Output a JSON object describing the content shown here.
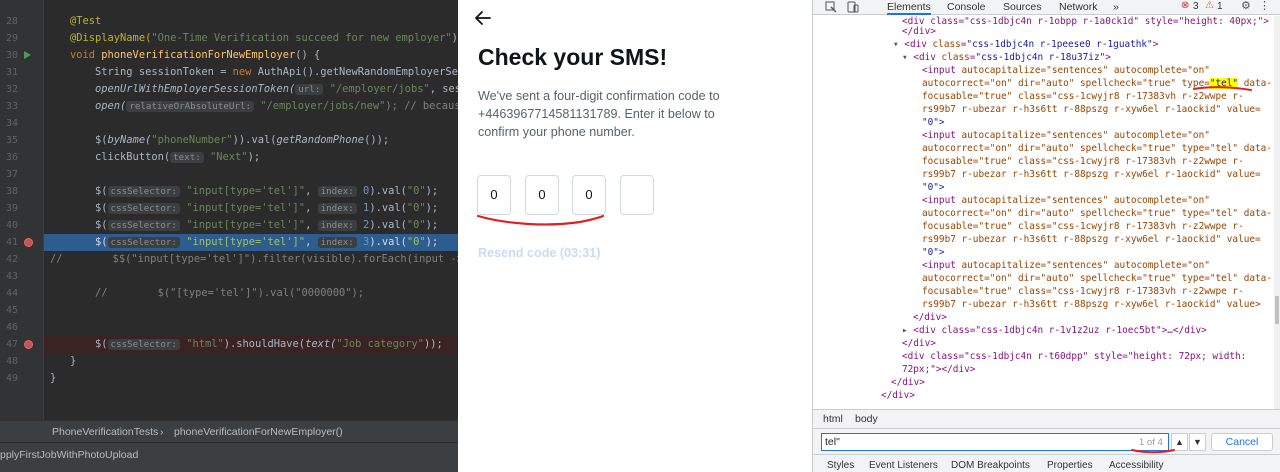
{
  "ide": {
    "line_numbers": [
      "28",
      "29",
      "30",
      "31",
      "32",
      "33",
      "34",
      "35",
      "36",
      "37",
      "38",
      "39",
      "40",
      "41",
      "42",
      "43",
      "44",
      "45",
      "46",
      "47",
      "48",
      "49"
    ],
    "annotation_test": "@Test",
    "display_name_call": "@DisplayName(",
    "display_name_value": "\"One-Time Verification succeed for new employer\"",
    "display_name_close": ")",
    "method_sig_kw": "void ",
    "method_name": "phoneVerificationForNewEmployer",
    "method_sig_end": "() {",
    "l31a": "    String sessionToken = ",
    "l31b": "new ",
    "l31c": "AuthApi().getNewRandomEmployerSessi",
    "l32a": "    openUrlWithEmployerSessionToken(",
    "l32hint": "url:",
    "l32b": " \"/employer/jobs\"",
    "l32c": ", sessio",
    "l33a": "    open(",
    "l33hint": "relativeOrAbsoluteUrl:",
    "l33b": " \"/employer/jobs/new\"",
    "l33c": "); // because of",
    "l35a": "    $(",
    "l35b": "byName(",
    "l35c": "\"phoneNumber\"",
    "l35d": ")).val(",
    "l35e": "getRandomPhone",
    "l35f": "());",
    "l36a": "    clickButton(",
    "l36hint": "text:",
    "l36b": " \"Next\"",
    "l36c": ");",
    "dollar": "    $(",
    "css_hint": "cssSelector:",
    "tel_selector": " \"input[type='tel']\"",
    "comma": ",",
    "index_hint": "index:",
    "idx0": " 0",
    "idx1": " 1",
    "idx2": " 2",
    "idx3": " 3",
    "val_zero_a": ").val(",
    "val_zero_b": "\"0\"",
    "val_zero_c": ");",
    "l42": "//        $$(\"input[type='tel']\").filter(visible).forEach(input -> in",
    "l44": "    //        $(\"[type='tel']\").val(\"0000000\");",
    "html_selector": " \"html\"",
    "should_have": ").shouldHave(",
    "text_fn": "text(",
    "job_category": "\"Job category\"",
    "should_close": "));",
    "brace_close_inner": "}",
    "brace_close_outer": "}",
    "breadcrumb_class": "PhoneVerificationTests",
    "breadcrumb_sep": "›",
    "breadcrumb_method": "phoneVerificationForNewEmployer()",
    "run_config": "pplyFirstJobWithPhotoUpload"
  },
  "page": {
    "title": "Check your SMS!",
    "description": "We've sent a four-digit confirmation code to +4463967714581131789. Enter it below to confirm your phone number.",
    "code_digits": [
      "0",
      "0",
      "0",
      ""
    ],
    "resend": "Resend code (03:31)"
  },
  "devtools": {
    "tabs": [
      "Elements",
      "Console",
      "Sources",
      "Network",
      "»"
    ],
    "error_count": "3",
    "warning_count": "1",
    "tree": {
      "line0": "<div class=\"css-1dbjc4n r-1obpp r-1a0ck1d\" style=\"height: 40px;\">",
      "line1": "</div>",
      "line2_tag": "<div ",
      "line2_attr": "class",
      "line2_val": "\"css-1dbjc4n r-1peese0 r-1guathk\"",
      "line3_val": "\"css-1dbjc4n r-18u37iz\"",
      "input_attrs_1": "autocapitalize=\"sentences\" autocomplete=\"on\"",
      "input_attrs_2a": "autocorrect=\"on\" dir=\"auto\" spellcheck=\"true\" type=",
      "input_attrs_2b": "\"tel\"",
      "input_attrs_2c": " data-",
      "input_attrs_2_plain": "autocorrect=\"on\" dir=\"auto\" spellcheck=\"true\" type=\"tel\" data-",
      "input_attrs_3": "focusable=\"true\" class=\"css-1cwyjr8 r-17383vh r-z2wwpe r-",
      "input_attrs_4": "rs99b7 r-ubezar r-h3s6tt r-88pszg r-xyw6el r-1aockid\" value=",
      "input_attrs_5": "\"0\">",
      "input_attrs_5_last": "\"0\">",
      "line_closed_div": "<div class=\"css-1dbjc4n r-1v1z2uz r-1oec5bt\">…</div>",
      "line_close_div": "</div>",
      "line_spacer_a": "<div class=\"css-1dbjc4n r-t60dpp\" style=\"height: 72px; width:",
      "line_spacer_b": "72px;\"></div>",
      "last_val_line": "rs99b7 r-ubezar r-h3s6tt r-88pszg r-xyw6el r-1aockid\" value>",
      "input_open": "<input "
    },
    "crumbs": [
      "html",
      "body"
    ],
    "search_value": "tel\"",
    "search_count": "1 of 4",
    "cancel_label": "Cancel",
    "bottom_tabs": [
      "Styles",
      "Event Listeners",
      "DOM Breakpoints",
      "Properties",
      "Accessibility"
    ]
  },
  "colors": {
    "ide_bg": "#2b2b2b",
    "selection": "#2d5c8f",
    "breakpoint": "#c75450",
    "annotation_red": "#e02020",
    "devtools_accent": "#1a73e8"
  }
}
